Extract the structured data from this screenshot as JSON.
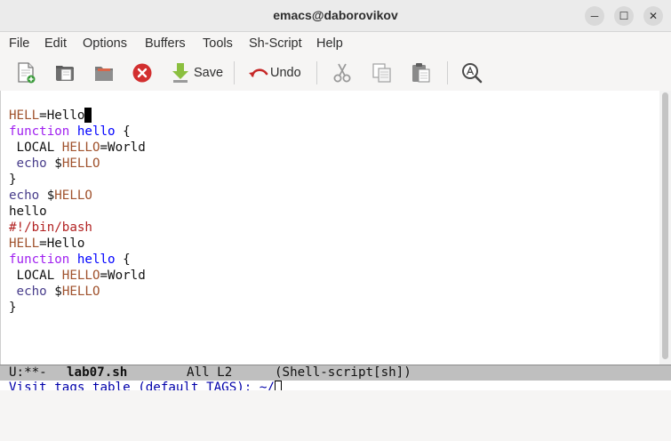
{
  "window": {
    "title": "emacs@daborovikov",
    "minimize_glyph": "─",
    "maximize_glyph": "☐",
    "close_glyph": "✕"
  },
  "menu": {
    "items": [
      "File",
      "Edit",
      "Options",
      "Buffers",
      "Tools",
      "Sh-Script",
      "Help"
    ]
  },
  "toolbar": {
    "save_label": "Save",
    "undo_label": "Undo",
    "icons": [
      "new-file-icon",
      "open-folder-icon",
      "open-directory-icon",
      "close-buffer-icon",
      "save-icon",
      "undo-icon",
      "cut-icon",
      "copy-icon",
      "paste-icon",
      "search-icon"
    ],
    "close_color": "#d22f2f"
  },
  "editor": {
    "lines": [
      [
        {
          "t": "HELL",
          "c": "var"
        },
        {
          "t": "=Hello",
          "c": ""
        }
      ],
      [
        {
          "t": "function",
          "c": "kw"
        },
        {
          "t": " ",
          "c": ""
        },
        {
          "t": "hello",
          "c": "fn"
        },
        {
          "t": " {",
          "c": ""
        }
      ],
      [
        {
          "t": " LOCAL ",
          "c": ""
        },
        {
          "t": "HELLO",
          "c": "var"
        },
        {
          "t": "=World",
          "c": ""
        }
      ],
      [
        {
          "t": " ",
          "c": ""
        },
        {
          "t": "echo",
          "c": "bi"
        },
        {
          "t": " $",
          "c": ""
        },
        {
          "t": "HELLO",
          "c": "var"
        }
      ],
      [
        {
          "t": "}",
          "c": ""
        }
      ],
      [
        {
          "t": "echo",
          "c": "bi"
        },
        {
          "t": " $",
          "c": ""
        },
        {
          "t": "HELLO",
          "c": "var"
        }
      ],
      [
        {
          "t": "hello",
          "c": ""
        }
      ],
      [
        {
          "t": "#!/bin/bash",
          "c": "cm"
        }
      ],
      [
        {
          "t": "HELL",
          "c": "var"
        },
        {
          "t": "=Hello",
          "c": ""
        }
      ],
      [
        {
          "t": "function",
          "c": "kw"
        },
        {
          "t": " ",
          "c": ""
        },
        {
          "t": "hello",
          "c": "fn"
        },
        {
          "t": " {",
          "c": ""
        }
      ],
      [
        {
          "t": " LOCAL ",
          "c": ""
        },
        {
          "t": "HELLO",
          "c": "var"
        },
        {
          "t": "=World",
          "c": ""
        }
      ],
      [
        {
          "t": " ",
          "c": ""
        },
        {
          "t": "echo",
          "c": "bi"
        },
        {
          "t": " $",
          "c": ""
        },
        {
          "t": "HELLO",
          "c": "var"
        }
      ],
      [
        {
          "t": "}",
          "c": ""
        }
      ]
    ],
    "cursor_line": 0
  },
  "modeline": {
    "status": "U:**-",
    "buffer": "lab07.sh",
    "position": "All L2",
    "mode": "(Shell-script[sh])"
  },
  "minibuffer": {
    "prompt": "Visit tags table (default TAGS): ~/"
  },
  "colors": {
    "variable": "#a0522d",
    "keyword": "#a020f0",
    "function_name": "#0000ff",
    "builtin": "#483d8b",
    "comment": "#b22222"
  }
}
